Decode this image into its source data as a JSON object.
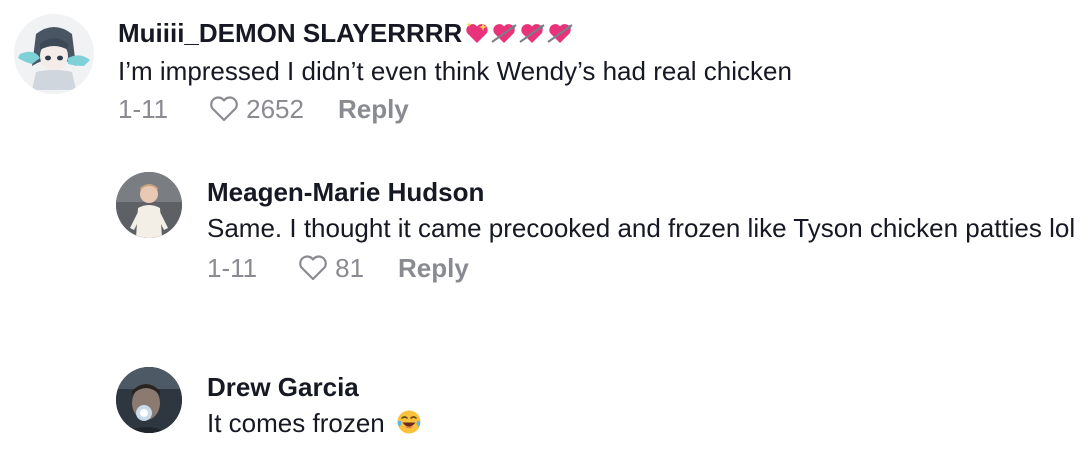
{
  "comments": [
    {
      "author": "Muiiii_DEMON SLAYERRRR",
      "badge_icons": [
        "sparkling-heart-icon",
        "heart-with-arrow-icon",
        "heart-with-arrow-icon",
        "heart-with-arrow-icon"
      ],
      "text": "I’m impressed I didn’t even think Wendy’s had real chicken",
      "date": "1-11",
      "likes": "2652",
      "reply_label": "Reply"
    },
    {
      "author": "Meagen-Marie Hudson",
      "text": "Same. I thought it came precooked and frozen like Tyson chicken patties lol",
      "date": "1-11",
      "likes": "81",
      "reply_label": "Reply"
    },
    {
      "author": "Drew Garcia",
      "text": "It comes frozen",
      "text_emoji": "face-with-tears-of-joy-icon"
    }
  ],
  "colors": {
    "text": "#161823",
    "meta": "#8a8b91",
    "badge_pink": "#e8337a"
  }
}
